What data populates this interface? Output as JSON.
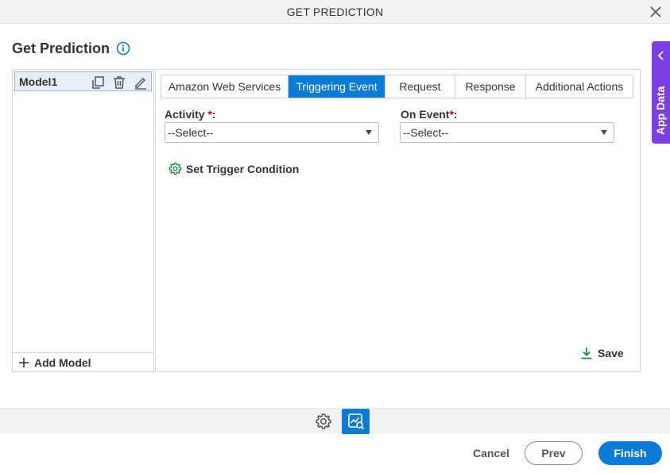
{
  "window": {
    "title": "GET PREDICTION",
    "close_icon": "close-icon"
  },
  "heading": {
    "title": "Get Prediction",
    "info_icon": "info-icon"
  },
  "app_data": {
    "label": "App Data"
  },
  "models": {
    "items": [
      {
        "label": "Model1"
      }
    ],
    "add_label": "Add Model"
  },
  "tabs": [
    {
      "label": "Amazon Web Services",
      "active": false
    },
    {
      "label": "Triggering Event",
      "active": true
    },
    {
      "label": "Request",
      "active": false
    },
    {
      "label": "Response",
      "active": false
    },
    {
      "label": "Additional Actions",
      "active": false
    }
  ],
  "form": {
    "activity": {
      "label": "Activity ",
      "required_mark": "*",
      "suffix": ":",
      "value": "--Select--"
    },
    "on_event": {
      "label": "On Event",
      "required_mark": "*",
      "suffix": ":",
      "value": "--Select--"
    },
    "trigger_condition": "Set Trigger Condition",
    "save_label": "Save"
  },
  "footer": {
    "cancel": "Cancel",
    "prev": "Prev",
    "finish": "Finish"
  },
  "colors": {
    "accent": "#0a7bd6",
    "app_data": "#7b3fe4",
    "success_icon": "#1a8a3a",
    "required": "#d0021b"
  }
}
